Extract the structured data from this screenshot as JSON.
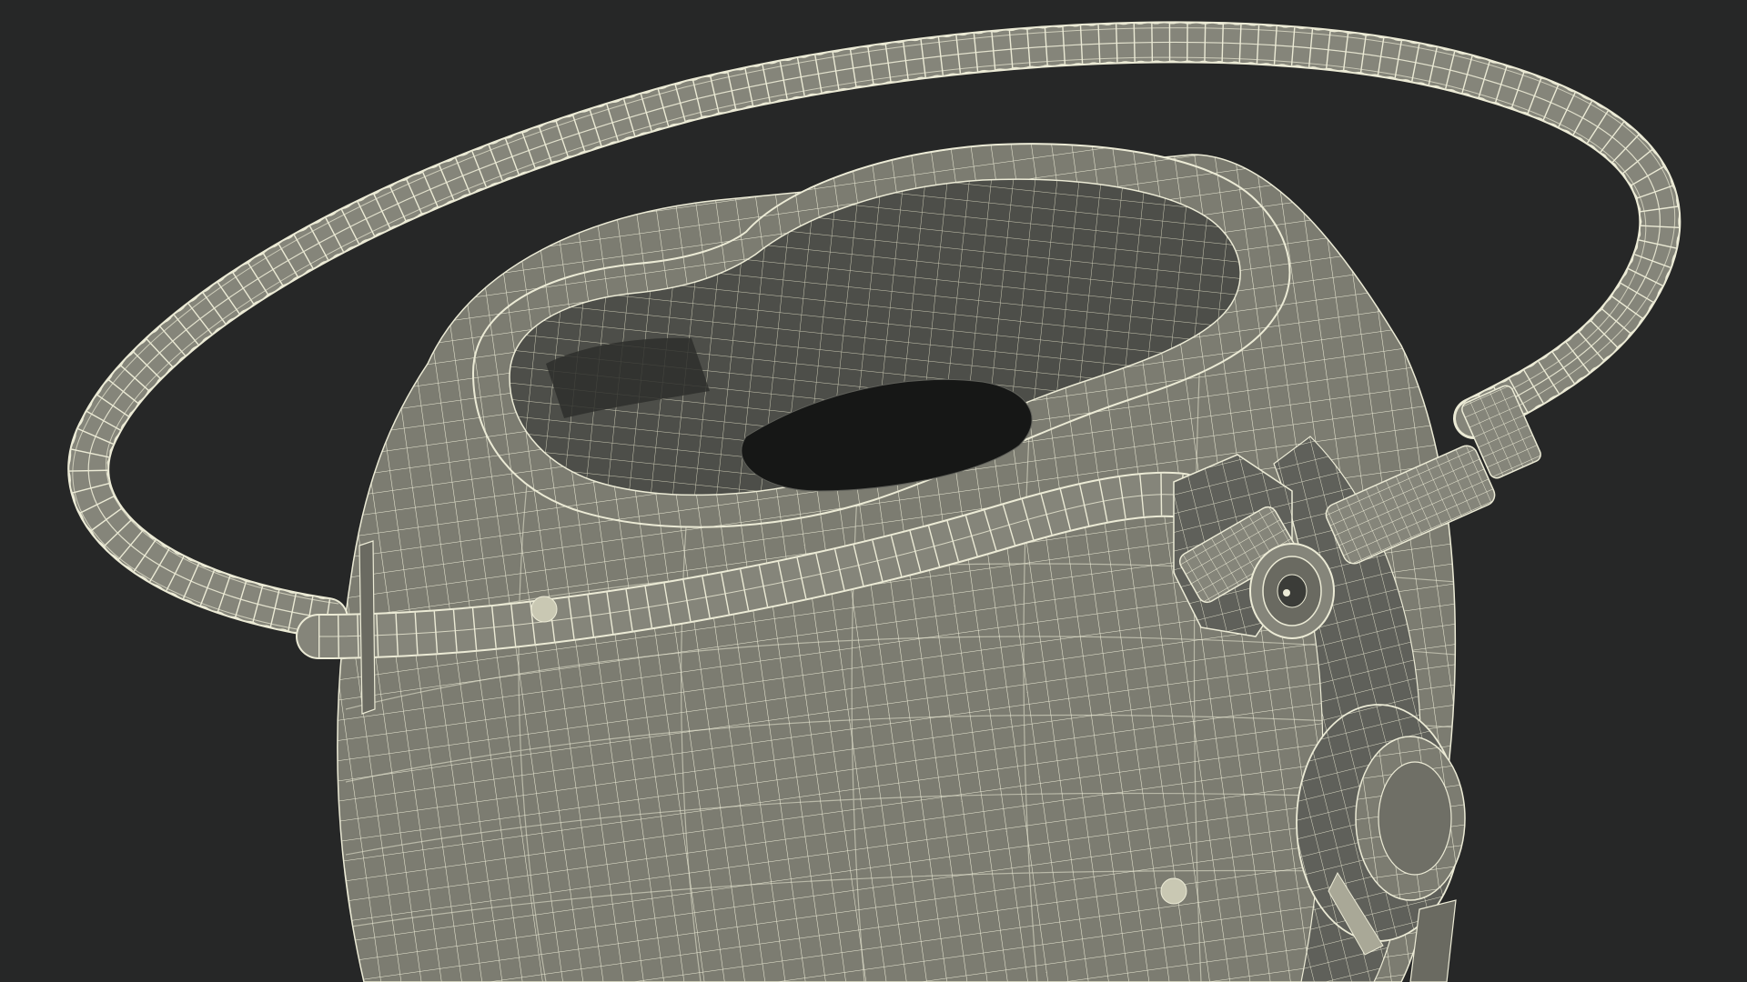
{
  "scene": {
    "subject": "wireframe-3d-model",
    "colors": {
      "background": "#262727",
      "surface": "#7c7c71",
      "surface_dark": "#5f605a",
      "inner": "#4d4e49",
      "cavity": "#161716",
      "wire": "#ecebd6",
      "wire_soft": "#d9d8c4",
      "hose": "#85857a"
    }
  }
}
